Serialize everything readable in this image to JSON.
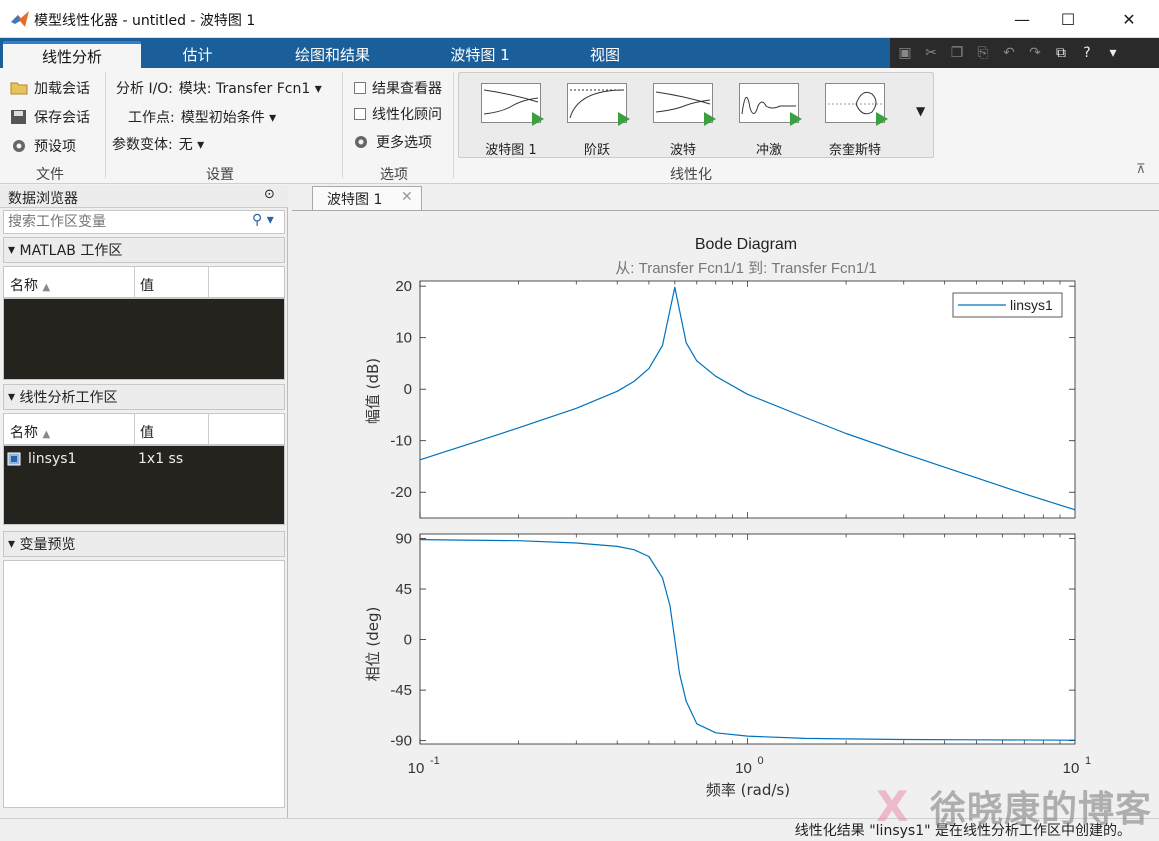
{
  "window": {
    "title": "模型线性化器 - untitled - 波特图 1",
    "minimize": "—",
    "maximize": "☐",
    "close": "✕"
  },
  "tabs": [
    {
      "label": "线性分析"
    },
    {
      "label": "估计"
    },
    {
      "label": "绘图和结果"
    },
    {
      "label": "波特图 1"
    },
    {
      "label": "视图"
    }
  ],
  "ribbon": {
    "file": {
      "load": "加载会话",
      "save": "保存会话",
      "prefs": "预设项",
      "label": "文件"
    },
    "settings": {
      "io_label": "分析 I/O:",
      "io_value": "模块: Transfer Fcn1",
      "op_label": "工作点:",
      "op_value": "模型初始条件",
      "var_label": "参数变体:",
      "var_value": "无",
      "label": "设置"
    },
    "options": {
      "result_viewer": "结果查看器",
      "advisor": "线性化顾问",
      "more": "更多选项",
      "label": "选项"
    },
    "linearize": {
      "items": [
        "波特图 1",
        "阶跃",
        "波特",
        "冲激",
        "奈奎斯特"
      ],
      "label": "线性化"
    }
  },
  "browser": {
    "title": "数据浏览器",
    "search_placeholder": "搜索工作区变量",
    "matlab_ws": "MATLAB 工作区",
    "col_name": "名称",
    "col_value": "值",
    "lin_ws": "线性分析工作区",
    "rows": [
      {
        "name": "linsys1",
        "value": "1x1 ss"
      }
    ],
    "preview": "变量预览"
  },
  "doc_tab": "波特图 1",
  "plot": {
    "title": "Bode Diagram",
    "subtitle": "从: Transfer Fcn1/1  到: Transfer Fcn1/1",
    "mag_ylabel": "幅值 (dB)",
    "phase_ylabel": "相位 (deg)",
    "xlabel": "频率  (rad/s)",
    "legend": "linsys1",
    "line_color": "#0072bd"
  },
  "chart_data": {
    "type": "line",
    "title": "Bode Diagram",
    "xlabel": "频率  (rad/s)",
    "xscale": "log",
    "xlim": [
      0.1,
      10
    ],
    "xticks": [
      "10^-1",
      "10^0",
      "10^1"
    ],
    "legend_position": "top-right",
    "grid": false,
    "magnitude": {
      "ylabel": "幅值 (dB)",
      "ylim": [
        -25,
        20
      ],
      "yticks": [
        20,
        10,
        0,
        -10,
        -20
      ],
      "series": [
        {
          "name": "linsys1",
          "x": [
            0.1,
            0.15,
            0.2,
            0.3,
            0.4,
            0.45,
            0.5,
            0.55,
            0.6,
            0.65,
            0.7,
            0.8,
            1.0,
            1.5,
            2,
            3,
            5,
            7,
            10
          ],
          "y": [
            -13.7,
            -10.1,
            -7.5,
            -3.7,
            -0.4,
            1.5,
            4.0,
            8.5,
            19.8,
            9.0,
            5.5,
            2.5,
            -1.0,
            -5.5,
            -8.6,
            -12.5,
            -17.2,
            -20.3,
            -23.4
          ]
        }
      ]
    },
    "phase": {
      "ylabel": "相位 (deg)",
      "ylim": [
        -90,
        90
      ],
      "yticks": [
        90,
        45,
        0,
        -45,
        -90
      ],
      "series": [
        {
          "name": "linsys1",
          "x": [
            0.1,
            0.2,
            0.3,
            0.4,
            0.45,
            0.5,
            0.55,
            0.58,
            0.6,
            0.62,
            0.65,
            0.7,
            0.8,
            1.0,
            1.5,
            2,
            3,
            5,
            10
          ],
          "y": [
            89,
            88,
            86,
            83,
            80,
            74,
            55,
            30,
            0,
            -30,
            -55,
            -75,
            -83,
            -86,
            -88,
            -88.5,
            -89,
            -89.3,
            -89.6
          ]
        }
      ]
    }
  },
  "status": "线性化结果 \"linsys1\" 是在线性分析工作区中创建的。",
  "watermark": "徐晓康的博客"
}
